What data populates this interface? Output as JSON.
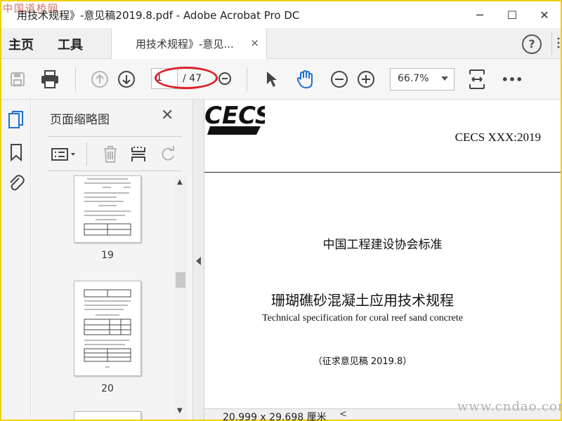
{
  "watermarks": {
    "top": "中国道桥网",
    "bottom": "www.cndao.com"
  },
  "window": {
    "title": "用技术规程》-意见稿2019.8.pdf - Adobe Acrobat Pro DC",
    "minimize": "─",
    "maximize": "☐",
    "close": "✕"
  },
  "tabs": {
    "home": "主页",
    "tools": "工具",
    "document": "用技术规程》-意见...",
    "close": "×",
    "help": "?"
  },
  "toolbar": {
    "current_page": "1",
    "total_pages": "/ 47",
    "zoom": "66.7%",
    "more": "•••"
  },
  "thumbnails": {
    "title": "页面缩略图",
    "close": "✕",
    "pages": [
      {
        "label": "19"
      },
      {
        "label": "20"
      }
    ]
  },
  "document": {
    "logo_text": "CECS",
    "standard_number": "CECS XXX:2019",
    "organization": "中国工程建设协会标准",
    "title_cn": "珊瑚礁砂混凝土应用技术规程",
    "title_en": "Technical specification for coral reef sand concrete",
    "draft_note": "（征求意见稿 2019.8）"
  },
  "status": {
    "page_size": "20.999 x 29.698 厘米"
  },
  "colors": {
    "frame": "#f0d000",
    "annotation_ring": "#d8232a",
    "hand_tool": "#1f6fd0",
    "pages_icon": "#1f6fd0"
  }
}
